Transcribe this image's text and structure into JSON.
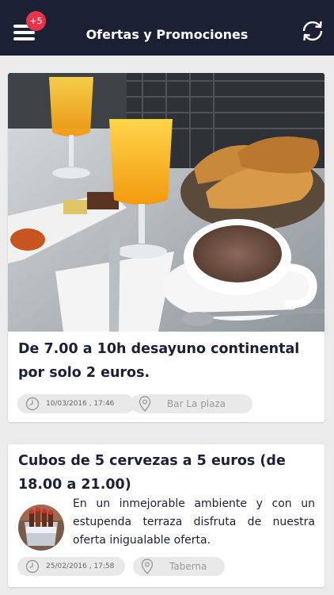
{
  "header": {
    "title": "Ofertas y Promociones",
    "notification_badge": "+5",
    "background": "#1b2035",
    "badge_color": "#e8344a"
  },
  "offers": [
    {
      "title": "De 7.00 a 10h desayuno continental por solo 2 euros.",
      "date": "10/03/2016 , 17:46",
      "place": "Bar La plaza",
      "image": "breakfast-photo"
    },
    {
      "title": "Cubos de 5 cervezas a 5 euros (de 18.00 a 21.00)",
      "description": "En un inmejorable ambiente y con un estupenda terraza disfruta de nuestra oferta inigualable oferta.",
      "date": "25/02/2016 , 17:58",
      "place": "Taberna",
      "image": "beer-bucket-thumbnail"
    }
  ]
}
